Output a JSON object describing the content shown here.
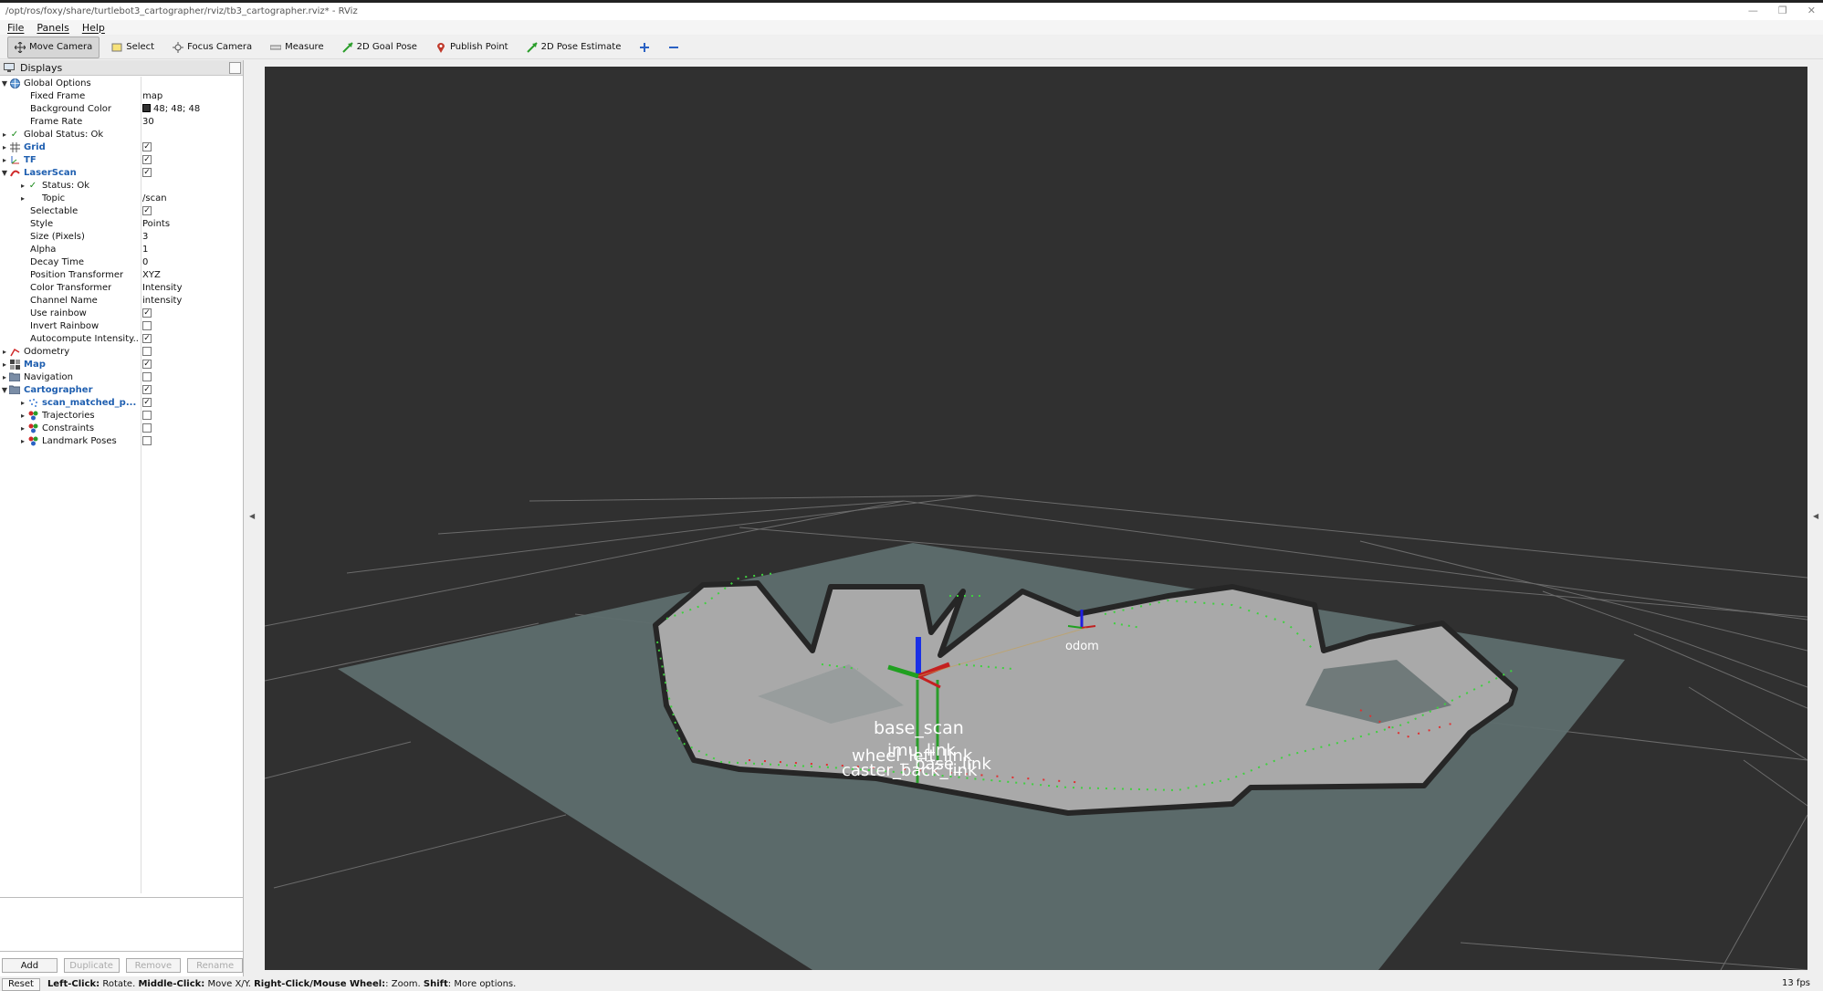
{
  "window": {
    "title": "/opt/ros/foxy/share/turtlebot3_cartographer/rviz/tb3_cartographer.rviz* - RViz"
  },
  "menu": {
    "file": "File",
    "panels": "Panels",
    "help": "Help"
  },
  "toolbar": {
    "move_camera": "Move Camera",
    "select": "Select",
    "focus_camera": "Focus Camera",
    "measure": "Measure",
    "goal_pose": "2D Goal Pose",
    "publish_point": "Publish Point",
    "pose_estimate": "2D Pose Estimate"
  },
  "displays_panel": {
    "title": "Displays",
    "rows": {
      "global_options": "Global Options",
      "fixed_frame": "Fixed Frame",
      "fixed_frame_val": "map",
      "background_color": "Background Color",
      "background_color_val": "48; 48; 48",
      "frame_rate": "Frame Rate",
      "frame_rate_val": "30",
      "global_status": "Global Status: Ok",
      "grid": "Grid",
      "tf": "TF",
      "laserscan": "LaserScan",
      "status_ok": "Status: Ok",
      "topic": "Topic",
      "topic_val": "/scan",
      "selectable": "Selectable",
      "style": "Style",
      "style_val": "Points",
      "size": "Size (Pixels)",
      "size_val": "3",
      "alpha": "Alpha",
      "alpha_val": "1",
      "decay_time": "Decay Time",
      "decay_time_val": "0",
      "position_transformer": "Position Transformer",
      "position_transformer_val": "XYZ",
      "color_transformer": "Color Transformer",
      "color_transformer_val": "Intensity",
      "channel_name": "Channel Name",
      "channel_name_val": "intensity",
      "use_rainbow": "Use rainbow",
      "invert_rainbow": "Invert Rainbow",
      "autocompute": "Autocompute Intensity...",
      "odometry": "Odometry",
      "map": "Map",
      "navigation": "Navigation",
      "cartographer": "Cartographer",
      "scan_matched": "scan_matched_p...",
      "trajectories": "Trajectories",
      "constraints": "Constraints",
      "landmark_poses": "Landmark Poses"
    },
    "buttons": {
      "add": "Add",
      "duplicate": "Duplicate",
      "remove": "Remove",
      "rename": "Rename"
    }
  },
  "viewport": {
    "background": "#303030",
    "frames": {
      "odom": "odom",
      "base_scan": "base_scan",
      "imu_link": "imu_link",
      "wheel_link": "wheel_left_link",
      "base_link": "base_link",
      "caster": "caster_back_link"
    }
  },
  "statusbar": {
    "reset": "Reset",
    "left_click": "Left-Click:",
    "left_click_desc": " Rotate. ",
    "middle_click": "Middle-Click:",
    "middle_click_desc": " Move X/Y. ",
    "right_click": "Right-Click/Mouse Wheel:",
    "right_click_desc": ": Zoom. ",
    "shift": "Shift",
    "shift_desc": ": More options.",
    "fps": "13 fps"
  }
}
